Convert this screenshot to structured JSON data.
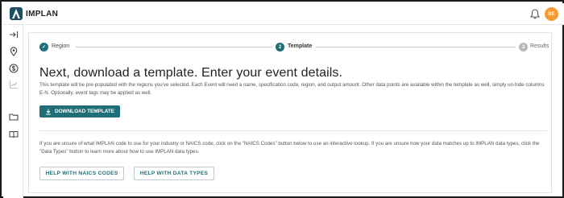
{
  "app": {
    "brand": "IMPLAN",
    "avatar_initials": "BE",
    "accent_color": "#1f6e78",
    "avatar_color": "#f59a32"
  },
  "sidebar": {
    "items": [
      {
        "icon": "arrow-right-to-bar-icon"
      },
      {
        "icon": "map-pin-icon"
      },
      {
        "icon": "dollar-circle-icon"
      },
      {
        "icon": "chart-icon"
      },
      {
        "icon": "folder-icon"
      },
      {
        "icon": "book-icon"
      }
    ]
  },
  "stepper": {
    "steps": [
      {
        "label": "Region",
        "state": "complete",
        "marker": "✓"
      },
      {
        "label": "Template",
        "state": "active",
        "marker": "2"
      },
      {
        "label": "Results",
        "state": "upcoming",
        "marker": "3"
      }
    ]
  },
  "main": {
    "title": "Next, download a template. Enter your event details.",
    "description": "This template will be pre-populated with the regions you've selected. Each Event will need a name, specification code, region, and output amount. Other data points are available within the template as well, simply un-hide columns E-N. Optionally, event tags may be applied as well.",
    "download_button": "DOWNLOAD TEMPLATE",
    "help_text": "If you are unsure of what IMPLAN code to use for your industry or NAICS code, click on the \"NAICS Codes\" button below to use an interactive lookup. If you are unsure how your data matches up to IMPLAN data types, click the \"Data Types\" button to learn more about how to use IMPLAN data types.",
    "naics_button": "HELP WITH NAICS CODES",
    "data_types_button": "HELP WITH DATA TYPES"
  }
}
